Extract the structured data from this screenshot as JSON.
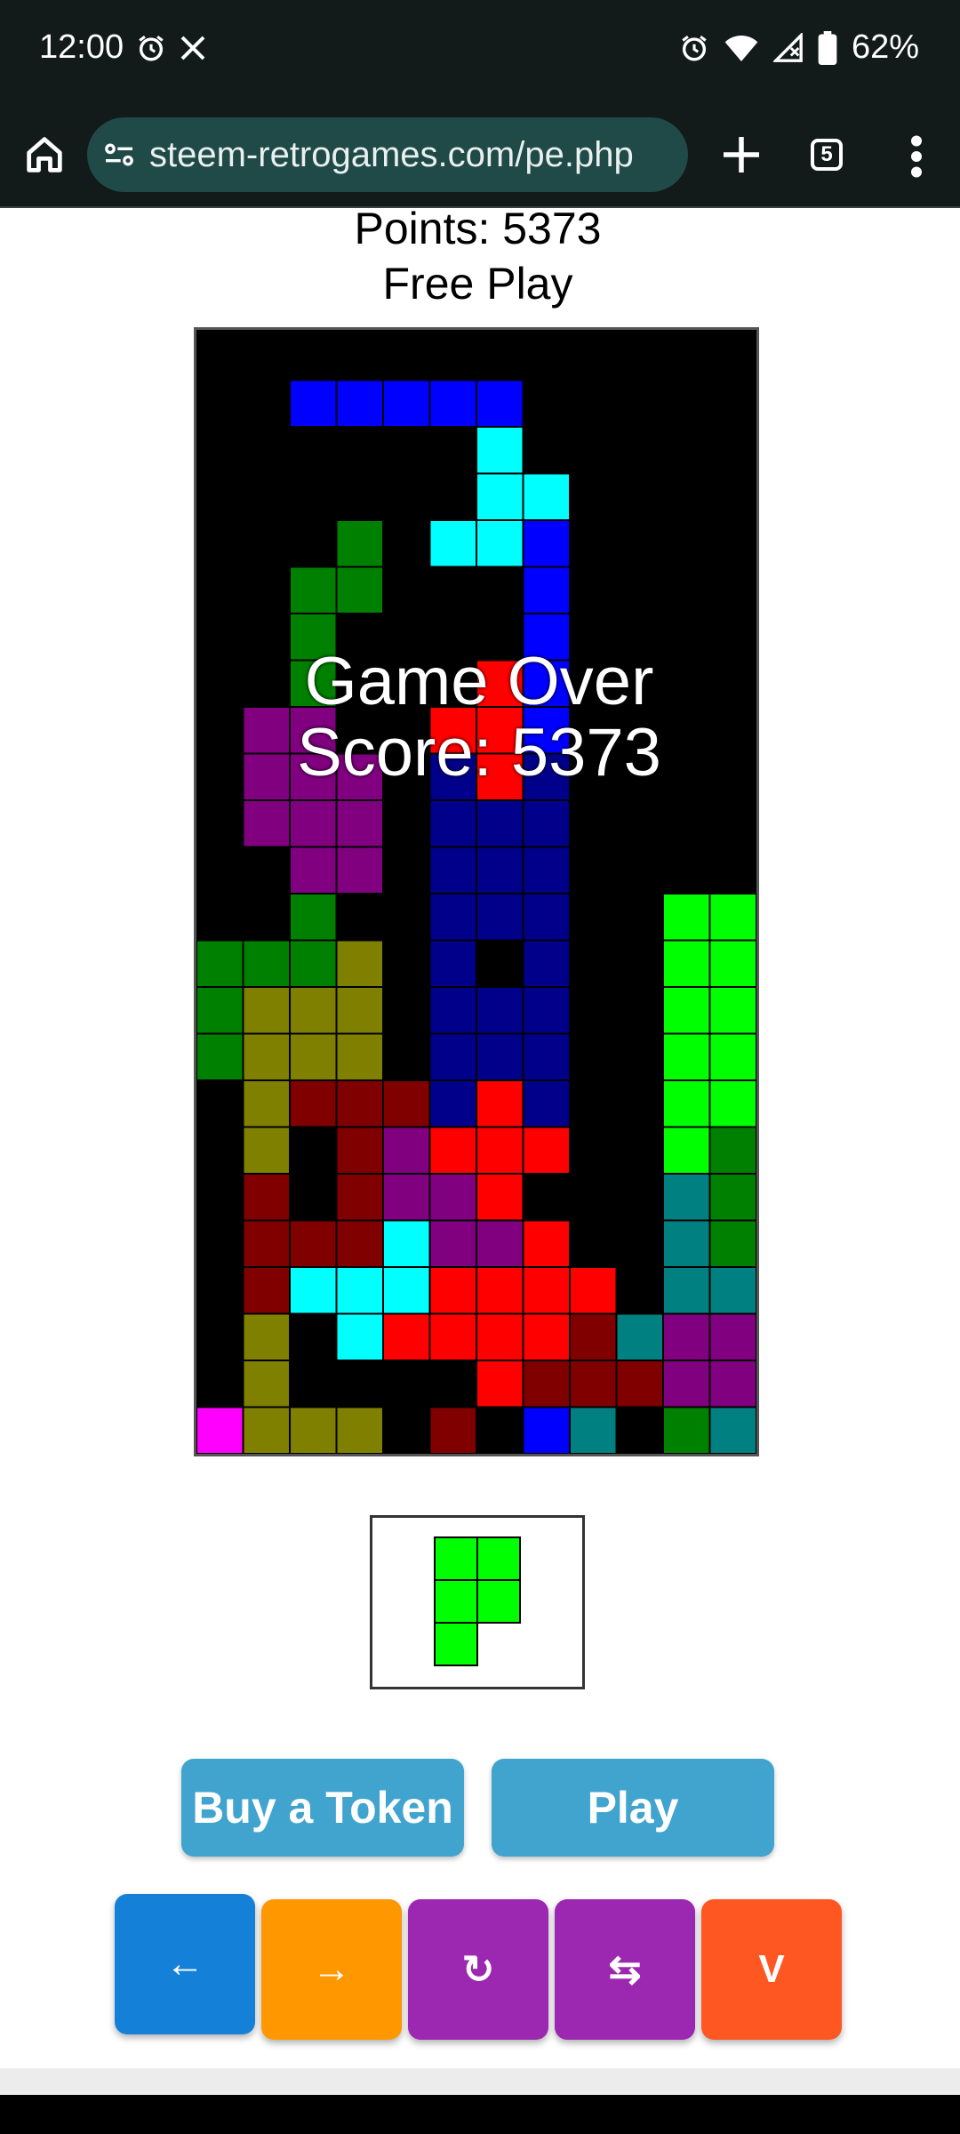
{
  "status_bar": {
    "time": "12:00",
    "battery": "62%",
    "icons": [
      "alarm-icon",
      "x-logo-icon",
      "alarm-icon",
      "wifi-icon",
      "signal-icon",
      "battery-icon"
    ]
  },
  "browser": {
    "url": "steem-retrogames.com/pe.php",
    "tab_count": "5"
  },
  "game": {
    "points_text": "Points: 5373",
    "mode_text": "Free Play",
    "overlay_line1": "Game Over",
    "overlay_line2": "Score: 5373",
    "board_cols": 12,
    "board_rows": 24,
    "colors": {
      "B": "#0000ff",
      "b": "#00008b",
      "C": "#00ffff",
      "G": "#008000",
      "L": "#00ff00",
      "P": "#800080",
      "R": "#ff0000",
      "r": "#800000",
      "O": "#808000",
      "T": "#008080",
      "M": "#ff00ff"
    },
    "grid": [
      "............",
      "..BBBBB.....",
      "......C.....",
      "......CC....",
      "...G.CCB....",
      "..GG...B....",
      "..G....B....",
      "..G...RB....",
      ".PP..RRB....",
      ".PPP.bRb....",
      ".PPP.bbb....",
      "..PP.bbb....",
      "..G..bbb..LL",
      "GGGO.b.b..LL",
      "GOOO.bbb..LL",
      "GOOO.bbb..LL",
      ".OrrrbRb..LL",
      ".O.rPRRR..LG",
      ".r.rPPR...TG",
      ".rrrCPPR..TGG",
      ".rCCCRRRR.TTG",
      ".O.CRRRRrTPP",
      ".O....RrrrPPT",
      "MOOO.r.BT.GT"
    ],
    "next_piece": {
      "color": "#00ff00",
      "cells": [
        [
          0,
          0
        ],
        [
          1,
          0
        ],
        [
          0,
          1
        ],
        [
          1,
          1
        ],
        [
          0,
          2
        ]
      ]
    }
  },
  "buttons": {
    "buy_token": "Buy a Token",
    "play": "Play"
  },
  "controls": [
    {
      "name": "left-button",
      "label": "←",
      "color": "#1580d8"
    },
    {
      "name": "right-button",
      "label": "→",
      "color": "#ff9800"
    },
    {
      "name": "rotate-button",
      "label": "↻",
      "color": "#9c27b0"
    },
    {
      "name": "swap-button",
      "label": "⇆",
      "color": "#9c27b0"
    },
    {
      "name": "drop-button",
      "label": "V",
      "color": "#ff5722"
    }
  ]
}
